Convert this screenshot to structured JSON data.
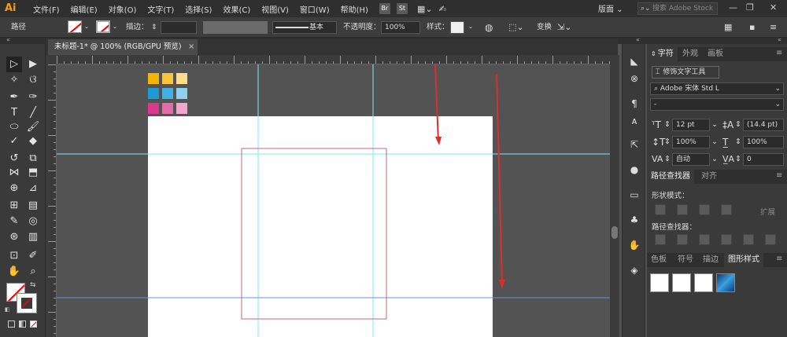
{
  "app": {
    "logo": "Ai",
    "workspace": "版面",
    "workspace_arrow": "⌄",
    "search_placeholder": "搜索 Adobe Stock",
    "minimize": "—",
    "restore": "❐",
    "close": "✕"
  },
  "menu": [
    "文件(F)",
    "编辑(E)",
    "对象(O)",
    "文字(T)",
    "选择(S)",
    "效果(C)",
    "视图(V)",
    "窗口(W)",
    "帮助(H)"
  ],
  "bridge_labels": {
    "br": "Br",
    "st": "St"
  },
  "control_bar": {
    "selection_label": "路径",
    "stroke_label": "描边：",
    "stroke_weight": "",
    "stroke_style": "基本",
    "opacity_label": "不透明度：",
    "opacity_value": "100%",
    "style_label": "样式：",
    "transform_label": "变换"
  },
  "document_tab": {
    "title": "未标题-1* @ 100% (RGB/GPU 预览)",
    "close": "×"
  },
  "character_panel": {
    "tabs": [
      "字符",
      "外观",
      "画板"
    ],
    "touch_tool": "修饰文字工具",
    "font_family": "Adobe 宋体 Std L",
    "font_style": "-",
    "font_size": "12 pt",
    "leading": "(14.4 pt)",
    "vertical_scale": "100%",
    "horizontal_scale": "100%",
    "kerning": "自动",
    "tracking": "0"
  },
  "pathfinder_panel": {
    "tabs": [
      "路径查找器",
      "对齐"
    ],
    "shape_modes_label": "形状模式：",
    "pathfinders_label": "路径查找器：",
    "expand_button": "扩展"
  },
  "graphic_styles_panel": {
    "tabs": [
      "色板",
      "符号",
      "描边",
      "图形样式"
    ]
  },
  "colors": {
    "swatches": [
      "#f5b400",
      "#f7c63a",
      "#fbdc8e",
      "#1a9ad6",
      "#44b0e2",
      "#8fd0ef",
      "#d9388e",
      "#e46aa8",
      "#f0a6cd"
    ],
    "guide_cyan": "#7fe8f0",
    "guide_blue": "#6a8fd8",
    "rectangle_stroke": "#c06a7a",
    "arrow_red": "#d9302c",
    "fill_indicator": "#d93a8a"
  },
  "icons": {
    "ctrl_dropdown": "chevron-down-icon",
    "panel_collapse": "double-chevron-icon"
  }
}
